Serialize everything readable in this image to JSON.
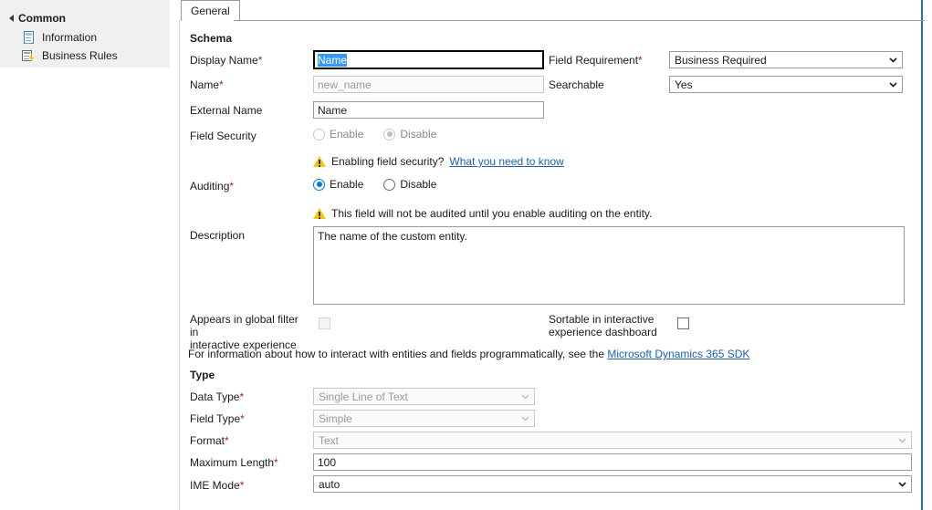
{
  "sidebar": {
    "group_label": "Common",
    "items": [
      {
        "label": "Information",
        "icon": "document-icon"
      },
      {
        "label": "Business Rules",
        "icon": "business-rule-icon"
      }
    ]
  },
  "tabs": [
    {
      "label": "General",
      "active": true
    }
  ],
  "sections": {
    "schema": {
      "heading": "Schema",
      "display_name": {
        "label": "Display Name",
        "required": "*",
        "value": "Name",
        "selected": true
      },
      "name": {
        "label": "Name",
        "required": "*",
        "value": "new_name",
        "disabled": true
      },
      "external_name": {
        "label": "External Name",
        "required": "",
        "value": "Name"
      },
      "field_requirement": {
        "label": "Field Requirement",
        "required": "*",
        "value": "Business Required"
      },
      "searchable": {
        "label": "Searchable",
        "required": "",
        "value": "Yes"
      },
      "field_security": {
        "label": "Field Security",
        "required": "",
        "enable_label": "Enable",
        "disable_label": "Disable",
        "selected": "Disable",
        "disabled": true
      },
      "field_security_warning": {
        "text": "Enabling field security?",
        "link_text": "What you need to know",
        "icon": "warning-icon"
      },
      "auditing": {
        "label": "Auditing",
        "required": "*",
        "enable_label": "Enable",
        "disable_label": "Disable",
        "selected": "Enable",
        "disabled": false
      },
      "auditing_warning": {
        "text": "This field will not be audited until you enable auditing on the entity.",
        "icon": "warning-icon"
      },
      "description": {
        "label": "Description",
        "required": "",
        "value": "The name of the custom entity."
      },
      "global_filter": {
        "label_line1": "Appears in global filter in",
        "label_line2": "interactive experience",
        "checked": false,
        "disabled": true
      },
      "sortable": {
        "label_line1": "Sortable in interactive",
        "label_line2": "experience dashboard",
        "checked": false,
        "disabled": false
      },
      "sdk_note": {
        "text": "For information about how to interact with entities and fields programmatically, see the",
        "link_text": "Microsoft Dynamics 365 SDK"
      }
    },
    "type": {
      "heading": "Type",
      "data_type": {
        "label": "Data Type",
        "required": "*",
        "value": "Single Line of Text",
        "disabled": true
      },
      "field_type": {
        "label": "Field Type",
        "required": "*",
        "value": "Simple",
        "disabled": true
      },
      "format": {
        "label": "Format",
        "required": "*",
        "value": "Text",
        "disabled": true
      },
      "maximum_length": {
        "label": "Maximum Length",
        "required": "*",
        "value": "100",
        "disabled": false
      },
      "ime_mode": {
        "label": "IME Mode",
        "required": "*",
        "value": "auto",
        "disabled": false
      }
    }
  },
  "colors": {
    "selection_blue": "#3399ff",
    "accent_blue": "#0078d7",
    "required_red": "#a4262c",
    "link_blue": "#1a5fb4",
    "warning_yellow": "#f2c811",
    "sidebar_grey": "#f0f0f0",
    "right_rule_blue": "#1a72c6"
  }
}
